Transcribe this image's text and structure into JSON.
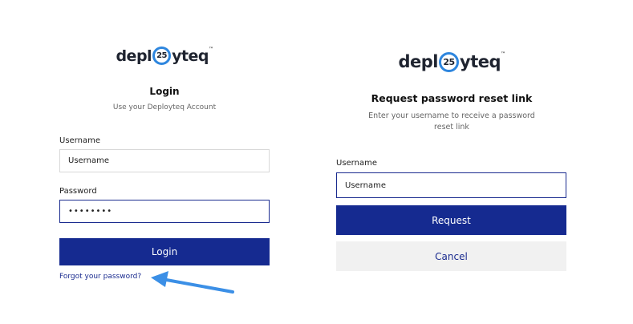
{
  "login": {
    "logo": {
      "part1": "depl",
      "badge": "25",
      "part2": "yteq",
      "trademark": "™"
    },
    "title": "Login",
    "subtitle": "Use your Deployteq Account",
    "username_label": "Username",
    "username_value": "Username",
    "password_label": "Password",
    "password_value": "••••••••",
    "login_button": "Login",
    "forgot_link": "Forgot your password?"
  },
  "reset": {
    "logo": {
      "part1": "depl",
      "badge": "25",
      "part2": "yteq",
      "trademark": "™"
    },
    "title": "Request password reset link",
    "subtitle_line1": "Enter your username to receive a password",
    "subtitle_line2": "reset link",
    "username_label": "Username",
    "username_value": "Username",
    "request_button": "Request",
    "cancel_button": "Cancel"
  },
  "annotation": {
    "arrow_icon": "arrow-pointer-icon",
    "arrow_color": "#3b8fe6"
  },
  "colors": {
    "primary": "#152a90",
    "link": "#1a2b8f",
    "logo_accent": "#2e86de"
  }
}
